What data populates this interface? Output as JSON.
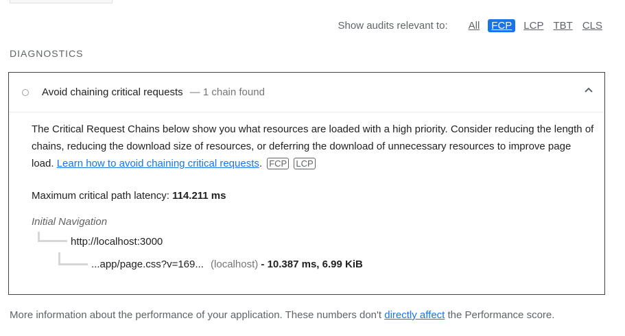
{
  "filters": {
    "label": "Show audits relevant to:",
    "options": [
      "All",
      "FCP",
      "LCP",
      "TBT",
      "CLS"
    ],
    "active": "FCP"
  },
  "section_title": "DIAGNOSTICS",
  "audit": {
    "title": "Avoid chaining critical requests",
    "display_value": "— 1 chain found",
    "description": "The Critical Request Chains below show you what resources are loaded with a high priority. Consider reducing the length of chains, reducing the download size of resources, or deferring the download of unnecessary resources to improve page load.",
    "learn_link": "Learn how to avoid chaining critical requests",
    "badges": [
      "FCP",
      "LCP"
    ],
    "latency_label": "Maximum critical path latency:",
    "latency_value": "114.211 ms",
    "tree": {
      "root_label": "Initial Navigation",
      "node1_url": "http://localhost:3000",
      "node2_url": "...app/page.css?v=169...",
      "node2_host": "(localhost)",
      "node2_metrics": "- 10.387 ms, 6.99 KiB"
    }
  },
  "footer": {
    "text_before": "More information about the performance of your application. These numbers don't ",
    "link": "directly affect",
    "text_after": " the Performance score."
  },
  "colors": {
    "accent": "#1a73e8",
    "border": "#424242"
  }
}
